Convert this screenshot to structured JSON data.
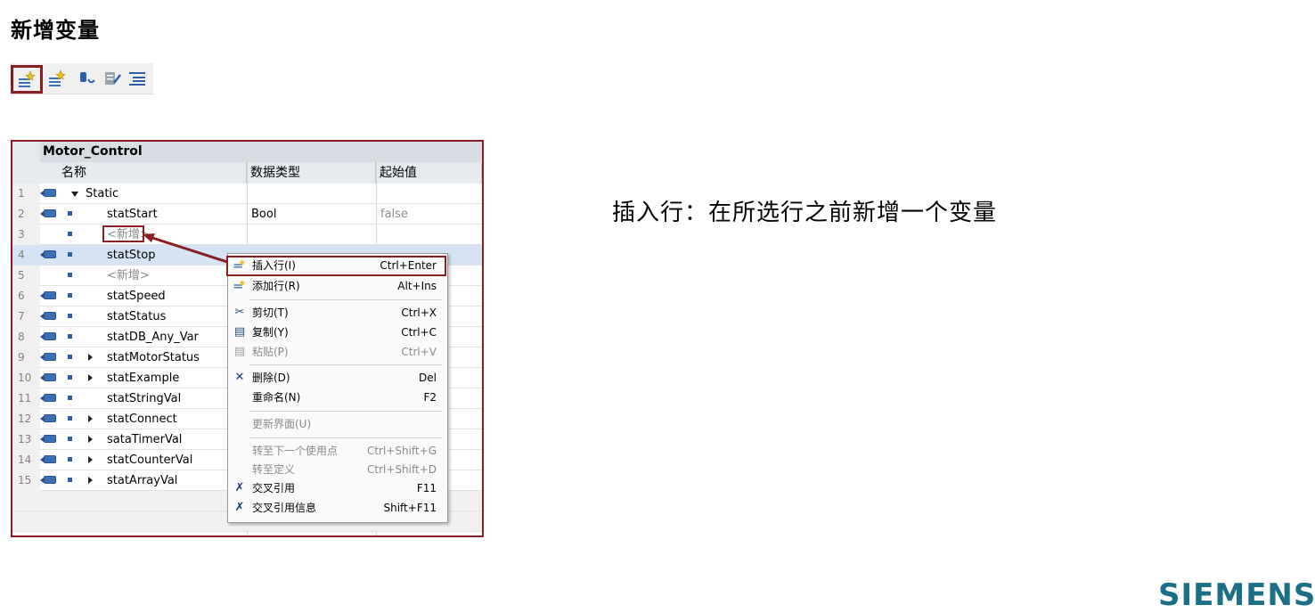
{
  "page": {
    "title": "新增变量",
    "description": "插入行：在所选行之前新增一个变量",
    "logo": "SIEMENS"
  },
  "toolbar": {
    "buttons": [
      {
        "icon": "insert-row-icon",
        "selected": true
      },
      {
        "icon": "add-row-icon",
        "selected": false
      },
      {
        "icon": "db-snapshot-icon",
        "selected": false
      },
      {
        "icon": "edit-start-values-icon",
        "selected": false
      },
      {
        "icon": "expand-all-icon",
        "selected": false
      }
    ]
  },
  "table": {
    "block_name": "Motor_Control",
    "columns": [
      "名称",
      "数据类型",
      "起始值"
    ],
    "rows": [
      {
        "num": "1",
        "name": "Static",
        "type": "",
        "value": ""
      },
      {
        "num": "2",
        "name": "statStart",
        "type": "Bool",
        "value": "false"
      },
      {
        "num": "3",
        "name": "<新增>",
        "type": "",
        "value": ""
      },
      {
        "num": "4",
        "name": "statStop",
        "type": "",
        "value": ""
      },
      {
        "num": "5",
        "name": "<新增>",
        "type": "",
        "value": ""
      },
      {
        "num": "6",
        "name": "statSpeed",
        "type": "",
        "value": ""
      },
      {
        "num": "7",
        "name": "statStatus",
        "type": "",
        "value": ""
      },
      {
        "num": "8",
        "name": "statDB_Any_Var",
        "type": "",
        "value": ""
      },
      {
        "num": "9",
        "name": "statMotorStatus",
        "type": "",
        "value": ""
      },
      {
        "num": "10",
        "name": "statExample",
        "type": "",
        "value": ""
      },
      {
        "num": "11",
        "name": "statStringVal",
        "type": "",
        "value": ""
      },
      {
        "num": "12",
        "name": "statConnect",
        "type": "",
        "value": ""
      },
      {
        "num": "13",
        "name": "sataTimerVal",
        "type": "",
        "value": ""
      },
      {
        "num": "14",
        "name": "statCounterVal",
        "type": "",
        "value": ""
      },
      {
        "num": "15",
        "name": "statArrayVal",
        "type": "",
        "value": ""
      }
    ]
  },
  "context_menu": {
    "items": [
      {
        "label": "插入行(I)",
        "shortcut": "Ctrl+Enter",
        "icon": "insert-row-icon"
      },
      {
        "label": "添加行(R)",
        "shortcut": "Alt+Ins",
        "icon": "add-row-icon"
      },
      {
        "label": "剪切(T)",
        "shortcut": "Ctrl+X",
        "icon": "scissors-icon"
      },
      {
        "label": "复制(Y)",
        "shortcut": "Ctrl+C",
        "icon": "copy-icon"
      },
      {
        "label": "粘贴(P)",
        "shortcut": "Ctrl+V",
        "icon": "paste-icon"
      },
      {
        "label": "删除(D)",
        "shortcut": "Del",
        "icon": "delete-icon"
      },
      {
        "label": "重命名(N)",
        "shortcut": "F2",
        "icon": ""
      },
      {
        "label": "更新界面(U)",
        "shortcut": "",
        "icon": ""
      },
      {
        "label": "转至下一个使用点",
        "shortcut": "Ctrl+Shift+G",
        "icon": ""
      },
      {
        "label": "转至定义",
        "shortcut": "Ctrl+Shift+D",
        "icon": ""
      },
      {
        "label": "交叉引用",
        "shortcut": "F11",
        "icon": "cross-reference-icon"
      },
      {
        "label": "交叉引用信息",
        "shortcut": "Shift+F11",
        "icon": "cross-reference-info-icon"
      }
    ]
  },
  "colors": {
    "highlight_border": "#8b1d24",
    "selected_row": "#d5e3f5",
    "logo": "#1b6f86"
  }
}
